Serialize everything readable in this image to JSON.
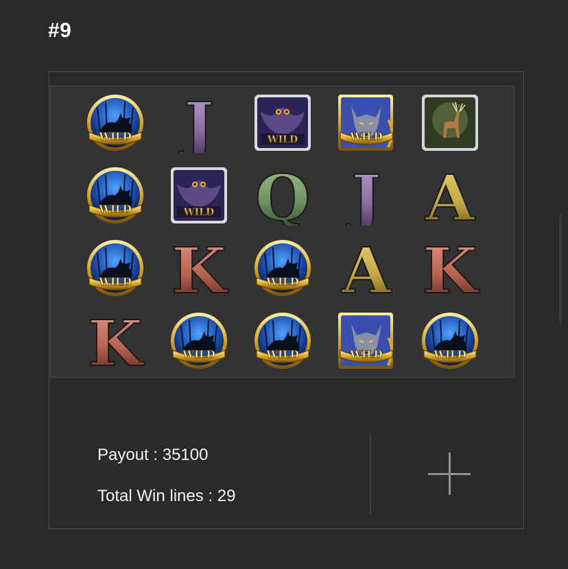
{
  "result": {
    "title": "#9",
    "payout_text": "Payout : 35100",
    "total_win_lines_text": "Total Win lines : 29"
  },
  "reels": {
    "rows": [
      [
        "wild",
        "J",
        "owl-wild",
        "wolf-wild",
        "deer"
      ],
      [
        "wild",
        "owl-wild",
        "Q",
        "J",
        "A"
      ],
      [
        "wild",
        "K",
        "wild",
        "A",
        "K"
      ],
      [
        "K",
        "wild",
        "wild",
        "wolf-wild",
        "wild"
      ]
    ],
    "wild_label": "WILD"
  },
  "colors": {
    "background": "#2a2a2b",
    "border": "#505052",
    "text": "#f2f2f2"
  },
  "icons": {
    "add": "plus-icon"
  }
}
